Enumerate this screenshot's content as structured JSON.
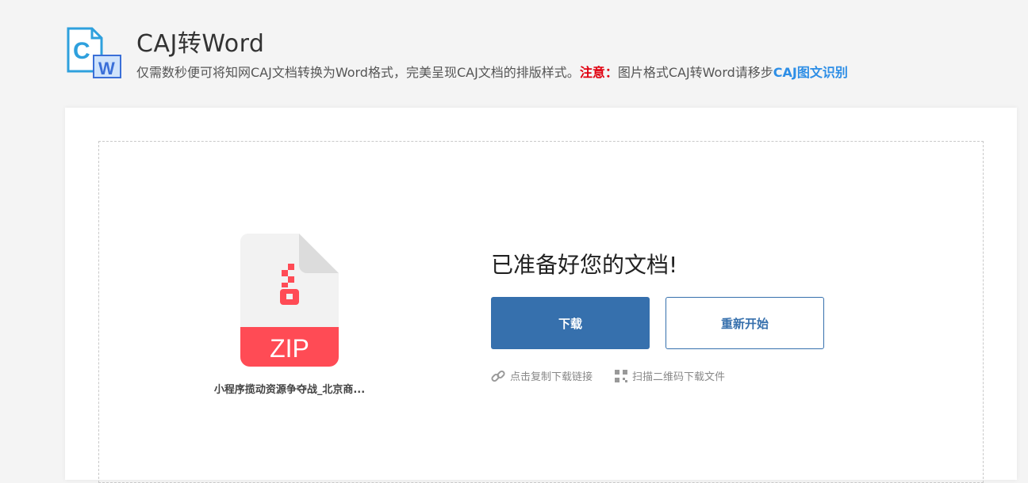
{
  "header": {
    "title": "CAJ转Word",
    "description": "仅需数秒便可将知网CAJ文档转换为Word格式，完美呈现CAJ文档的排版样式。",
    "warning_label": "注意：",
    "warning_text": "图片格式CAJ转Word请移步",
    "ocr_link": "CAJ图文识别",
    "logo_letters": [
      "C",
      "W"
    ]
  },
  "result": {
    "file_type": "ZIP",
    "file_name": "小程序揽动资源争夺战_北京商...",
    "ready_title": "已准备好您的文档!",
    "download_label": "下载",
    "restart_label": "重新开始",
    "copy_link_label": "点击复制下载链接",
    "qr_label": "扫描二维码下载文件"
  },
  "colors": {
    "primary": "#3670ad",
    "warning": "#e0000f",
    "link": "#2d8ee6",
    "zip_red": "#ff4b55",
    "page_bg": "#f4f4f4"
  }
}
